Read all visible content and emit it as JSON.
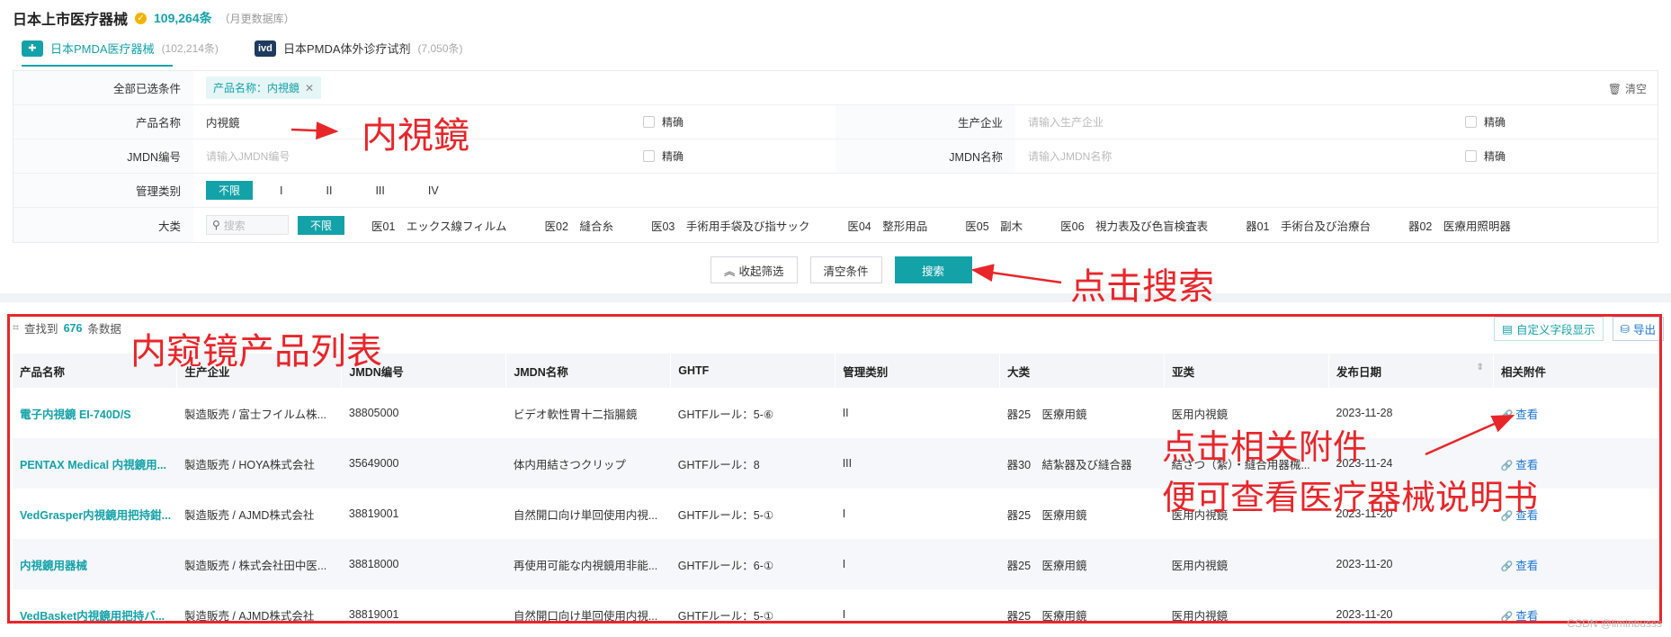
{
  "header": {
    "title": "日本上市医疗器械",
    "count": "109,264条",
    "sub": "（月更数据库）"
  },
  "tabs": [
    {
      "logo": "PMDA",
      "label": "日本PMDA医疗器械",
      "count": "(102,214条)"
    },
    {
      "logo": "ivd",
      "label": "日本PMDA体外诊疗试剂",
      "count": "(7,050条)"
    }
  ],
  "filters": {
    "selected_label": "全部已选条件",
    "chip": "产品名称：内視鏡",
    "clear": "清空",
    "product_label": "产品名称",
    "product_value": "内視鏡",
    "exact": "精确",
    "maker_label": "生产企业",
    "maker_ph": "请输入生产企业",
    "jmdn_no_label": "JMDN编号",
    "jmdn_no_ph": "请输入JMDN编号",
    "jmdn_name_label": "JMDN名称",
    "jmdn_name_ph": "请输入JMDN名称",
    "class_label": "管理类别",
    "class_opts": [
      "不限",
      "I",
      "II",
      "III",
      "IV"
    ],
    "cat_label": "大类",
    "cat_search_ph": "搜索",
    "cat_opts": [
      "不限",
      "医01　エックス線フィルム",
      "医02　縫合糸",
      "医03　手術用手袋及び指サック",
      "医04　整形用品",
      "医05　副木",
      "医06　視力表及び色盲検査表",
      "器01　手術台及び治療台",
      "器02　医療用照明器"
    ]
  },
  "buttons": {
    "collapse": "收起筛选",
    "reset": "清空条件",
    "search": "搜索"
  },
  "results": {
    "found_prefix": "查找到",
    "found_count": "676",
    "found_suffix": "条数据",
    "custom": "自定义字段显示",
    "export": "导出",
    "columns": [
      "产品名称",
      "生产企业",
      "JMDN编号",
      "JMDN名称",
      "GHTF",
      "管理类别",
      "大类",
      "亚类",
      "发布日期",
      "相关附件"
    ],
    "rows": [
      [
        "電子内視鏡 EI-740D/S",
        "製造販売 / 富士フイルム株...",
        "38805000",
        "ビデオ軟性胃十二指腸鏡",
        "GHTFルール：5-⑥",
        "II",
        "器25　医療用鏡",
        "医用内視鏡",
        "2023-11-28",
        "查看"
      ],
      [
        "PENTAX Medical 内視鏡用...",
        "製造販売 / HOYA株式会社",
        "35649000",
        "体内用結さつクリップ",
        "GHTFルール：8",
        "III",
        "器30　結紮器及び縫合器",
        "結さつ（紮）・縫合用器械...",
        "2023-11-24",
        "查看"
      ],
      [
        "VedGrasper内視鏡用把持鉗...",
        "製造販売 / AJMD株式会社",
        "38819001",
        "自然開口向け単回使用内視...",
        "GHTFルール：5-①",
        "I",
        "器25　医療用鏡",
        "医用内視鏡",
        "2023-11-20",
        "查看"
      ],
      [
        "内視鏡用器械",
        "製造販売 / 株式会社田中医...",
        "38818000",
        "再使用可能な内視鏡用非能...",
        "GHTFルール：6-①",
        "I",
        "器25　医療用鏡",
        "医用内視鏡",
        "2023-11-20",
        "查看"
      ],
      [
        "VedBasket内視鏡用把持バ...",
        "製造販売 / AJMD株式会社",
        "38819001",
        "自然開口向け単回使用内視...",
        "GHTFルール：5-①",
        "I",
        "器25　医療用鏡",
        "医用内視鏡",
        "2023-11-20",
        "查看"
      ]
    ]
  },
  "annotations": {
    "a1": "内視鏡",
    "a2": "点击搜索",
    "a3": "内窥镜产品列表",
    "a4": "点击相关附件",
    "a5": "便可查看医疗器械说明书"
  },
  "watermark": "CSDN @liminbusss"
}
